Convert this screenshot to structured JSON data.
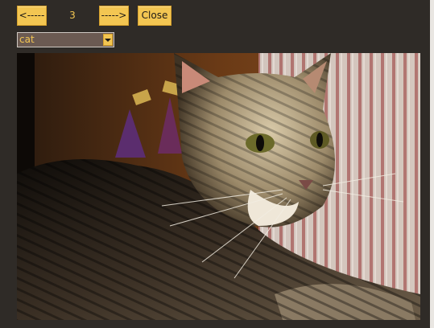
{
  "toolbar": {
    "prev_label": "<-----",
    "counter": "3",
    "next_label": "----->",
    "close_label": "Close"
  },
  "category_select": {
    "selected": "cat"
  },
  "photo": {
    "subject": "cat"
  },
  "colors": {
    "background": "#2f2b27",
    "button": "#f3c652",
    "accent_text": "#f3c652",
    "select_bg": "#6b5a52"
  },
  "icons": {
    "dropdown": "chevron-down-icon"
  }
}
